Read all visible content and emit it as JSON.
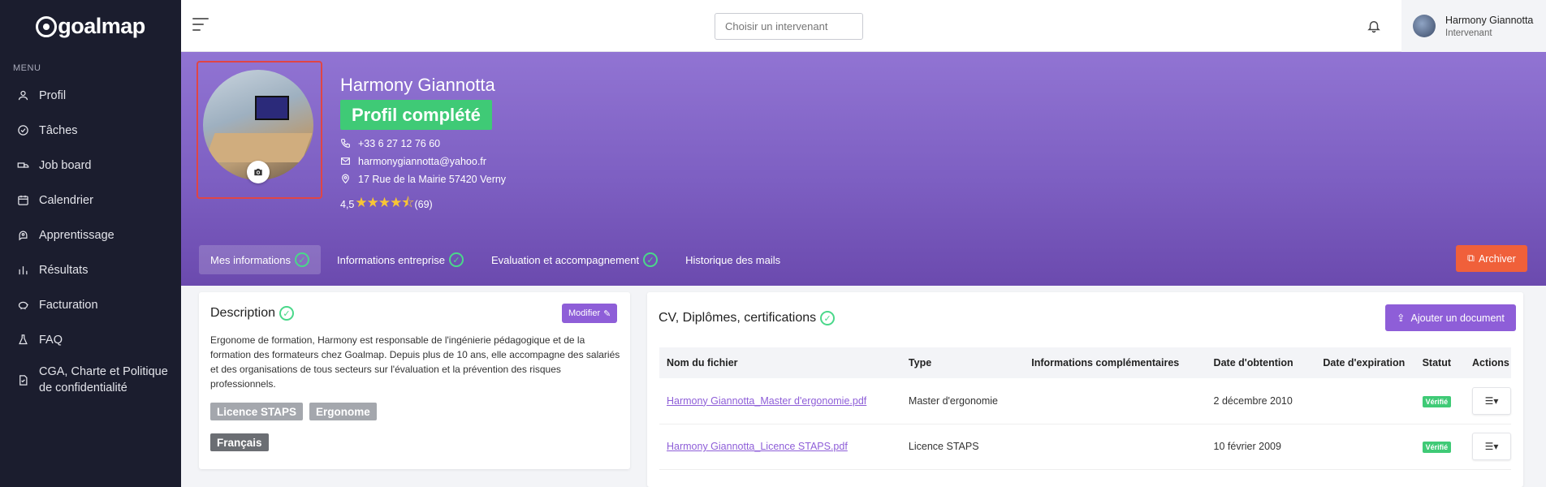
{
  "app": {
    "logo_text": "goalmap"
  },
  "sidebar": {
    "menu_title": "MENU",
    "items": [
      {
        "label": "Profil",
        "icon": "user-icon"
      },
      {
        "label": "Tâches",
        "icon": "check-circle-icon"
      },
      {
        "label": "Job board",
        "icon": "truck-icon"
      },
      {
        "label": "Calendrier",
        "icon": "calendar-icon"
      },
      {
        "label": "Apprentissage",
        "icon": "brain-icon"
      },
      {
        "label": "Résultats",
        "icon": "bar-chart-icon"
      },
      {
        "label": "Facturation",
        "icon": "piggy-bank-icon"
      },
      {
        "label": "FAQ",
        "icon": "flask-icon"
      },
      {
        "label": "CGA, Charte et Politique de confidentialité",
        "icon": "document-icon"
      }
    ]
  },
  "topbar": {
    "search_placeholder": "Choisir un intervenant",
    "user_name": "Harmony Giannotta",
    "user_role": "Intervenant"
  },
  "profile": {
    "name": "Harmony Giannotta",
    "status": "Profil complété",
    "phone": "+33 6 27 12 76 60",
    "email": "harmonygiannotta@yahoo.fr",
    "address": "17 Rue de la Mairie 57420 Verny",
    "rating": "4,5",
    "rating_value": 4.5,
    "rating_count": "(69)"
  },
  "tabs": [
    {
      "label": "Mes informations",
      "checked": true
    },
    {
      "label": "Informations entreprise",
      "checked": true
    },
    {
      "label": "Evaluation et accompagnement",
      "checked": true
    },
    {
      "label": "Historique des mails",
      "checked": false
    }
  ],
  "archive_label": "Archiver",
  "description": {
    "title": "Description",
    "modify_label": "Modifier",
    "text": "Ergonome de formation, Harmony est responsable de l'ingénierie pédagogique et de la formation des formateurs chez Goalmap. Depuis plus de 10 ans, elle accompagne des salariés et des organisations de tous secteurs sur l'évaluation et la prévention des risques professionnels.",
    "tags": [
      "Licence STAPS",
      "Ergonome"
    ],
    "languages": [
      "Français"
    ]
  },
  "documents": {
    "title": "CV, Diplômes, certifications",
    "add_label": "Ajouter un document",
    "columns": [
      "Nom du fichier",
      "Type",
      "Informations complémentaires",
      "Date d'obtention",
      "Date d'expiration",
      "Statut",
      "Actions"
    ],
    "rows": [
      {
        "file": "Harmony Giannotta_Master d'ergonomie.pdf",
        "type": "Master d'ergonomie",
        "info": "",
        "obtained": "2 décembre 2010",
        "expires": "",
        "status": "Vérifié"
      },
      {
        "file": "Harmony Giannotta_Licence STAPS.pdf",
        "type": "Licence STAPS",
        "info": "",
        "obtained": "10 février 2009",
        "expires": "",
        "status": "Vérifié"
      }
    ]
  }
}
